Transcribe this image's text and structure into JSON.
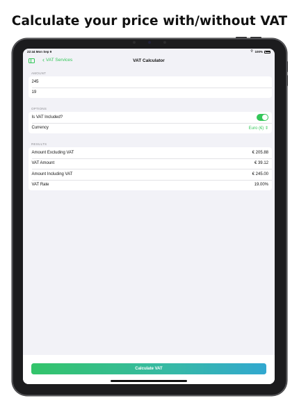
{
  "headline": "Calculate your price with/without VAT",
  "status_bar": {
    "time": "22:44  Mon Sep 9",
    "wifi": "wifi-icon",
    "battery": "100%"
  },
  "nav": {
    "back_label": "VAT Services",
    "title": "VAT Calculator"
  },
  "amount_section": {
    "header": "AMOUNT",
    "amount_value": "245",
    "rate_value": "19"
  },
  "options_section": {
    "header": "OPTIONS",
    "vat_included_label": "Is VAT Included?",
    "vat_included_on": true,
    "currency_label": "Currency",
    "currency_value": "Euro (€)",
    "currency_chevron": "⇕"
  },
  "results_section": {
    "header": "RESULTS",
    "rows": [
      {
        "label": "Amount Excluding VAT",
        "value": "€ 205.88"
      },
      {
        "label": "VAT Amount",
        "value": "€ 39.12"
      },
      {
        "label": "Amount Including VAT",
        "value": "€ 245.00"
      },
      {
        "label": "VAT Rate",
        "value": "19.00%"
      }
    ]
  },
  "calculate_button": "Calculate VAT",
  "colors": {
    "accent": "#34c759",
    "background": "#f2f2f7",
    "gradient_end": "#32a8d0"
  }
}
